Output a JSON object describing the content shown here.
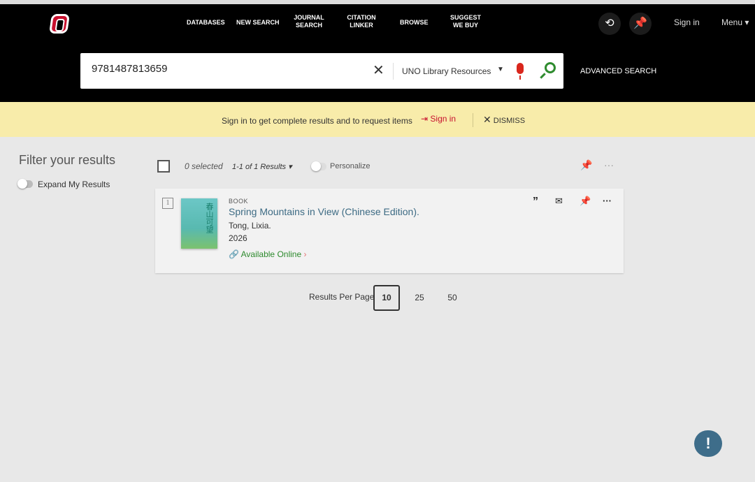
{
  "header": {
    "nav": [
      "DATABASES",
      "NEW SEARCH",
      "JOURNAL SEARCH",
      "CITATION LINKER",
      "BROWSE",
      "SUGGEST WE BUY"
    ],
    "sign_in": "Sign in",
    "menu": "Menu",
    "advanced_search": "ADVANCED SEARCH"
  },
  "search": {
    "query": "9781487813659",
    "scope": "UNO Library Resources"
  },
  "banner": {
    "message": "Sign in to get complete results and to request items",
    "sign_in": "Sign in",
    "dismiss": "DISMISS"
  },
  "filters": {
    "title": "Filter your results",
    "expand": "Expand My Results"
  },
  "results_bar": {
    "selected": "0 selected",
    "count": "1-1 of 1 Results",
    "personalize": "Personalize"
  },
  "result": {
    "index": "1",
    "type": "BOOK",
    "title": "Spring Mountains in View (Chinese Edition).",
    "author": "Tong, Lixia.",
    "year": "2026",
    "availability": "Available Online",
    "cover_text": "春山可望"
  },
  "pagination": {
    "label": "Results Per Page",
    "options": [
      "10",
      "25",
      "50"
    ],
    "selected": "10"
  },
  "help": {
    "icon": "!"
  },
  "colors": {
    "accent": "#c8102e",
    "link": "#3d6b84",
    "available": "#2d8a2d",
    "banner": "#f8ecaa"
  }
}
